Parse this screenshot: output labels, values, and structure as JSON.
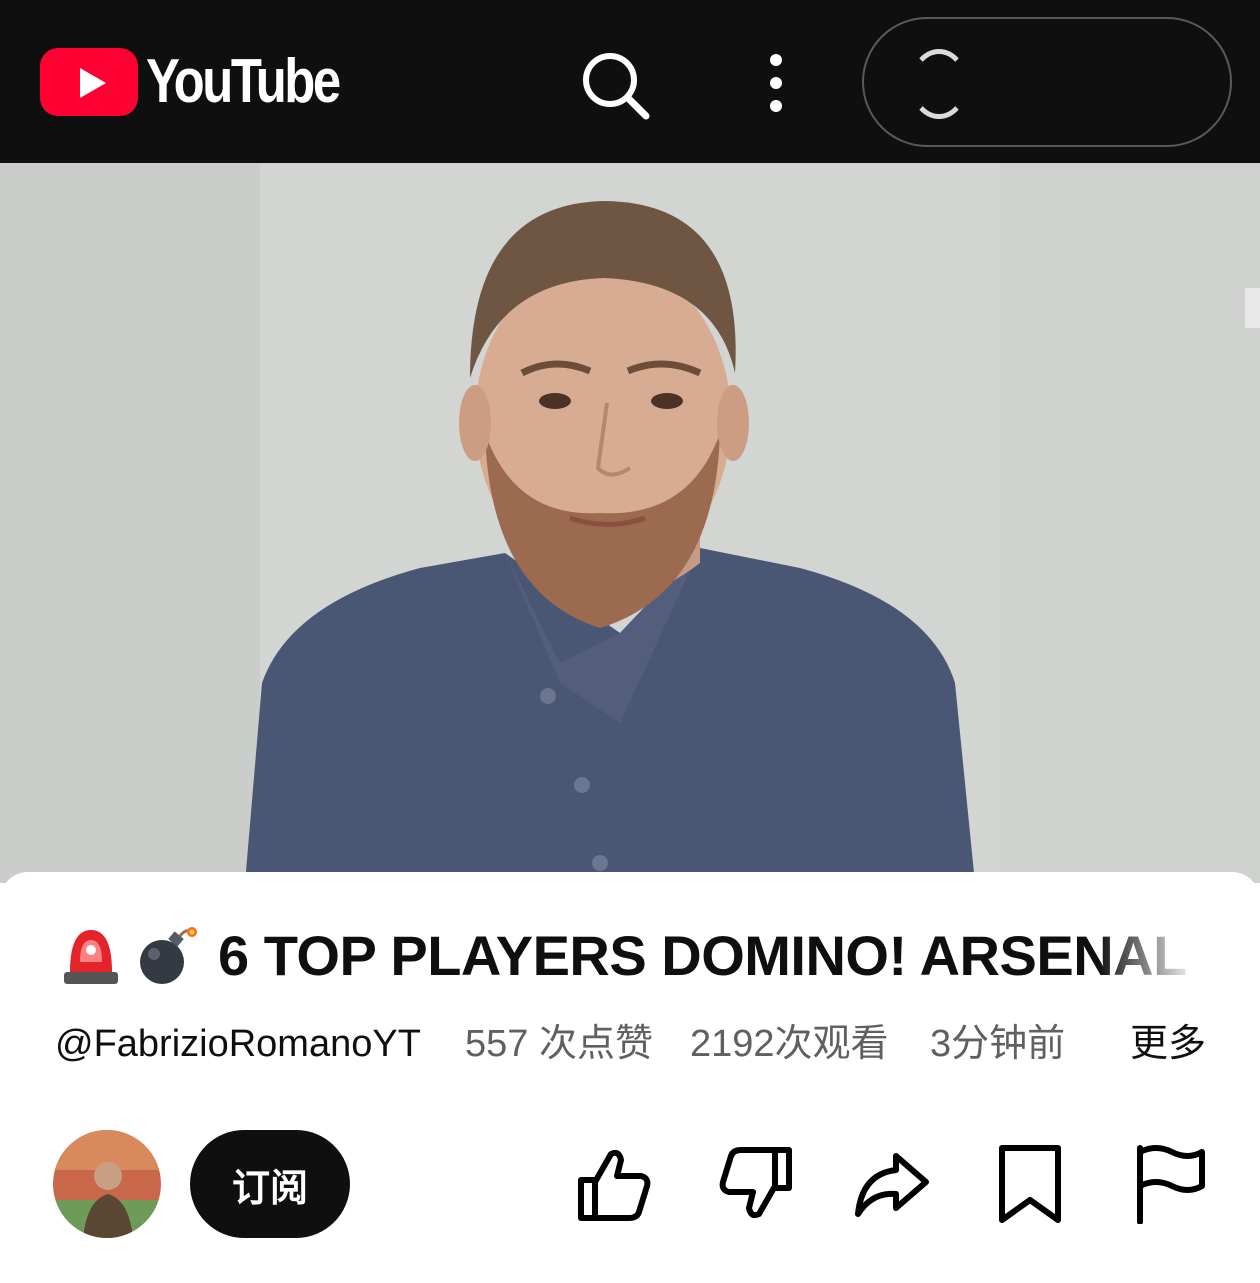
{
  "header": {
    "brand": "YouTube",
    "icons": [
      "youtube-logo-icon",
      "search-icon",
      "more-vert-icon"
    ],
    "account_state": "loading"
  },
  "colors": {
    "topbar_bg": "#0f0f0f",
    "brand_red": "#ff0033",
    "primary_text": "#0f0f0f",
    "secondary_text": "#606060",
    "subscribe_bg": "#0f0f0f"
  },
  "video": {
    "title_emojis": [
      "🚨",
      "💣"
    ],
    "title": "6 TOP PLAYERS DOMINO! ARSENAL"
  },
  "meta": {
    "channel_handle": "@FabrizioRomanoYT",
    "likes": "557 次点赞",
    "views": "2192次观看",
    "time": "3分钟前",
    "more_label": "更多"
  },
  "actions": {
    "subscribe_label": "订阅",
    "icons": [
      "thumb-up-icon",
      "thumb-down-icon",
      "share-icon",
      "bookmark-icon",
      "flag-icon"
    ]
  }
}
